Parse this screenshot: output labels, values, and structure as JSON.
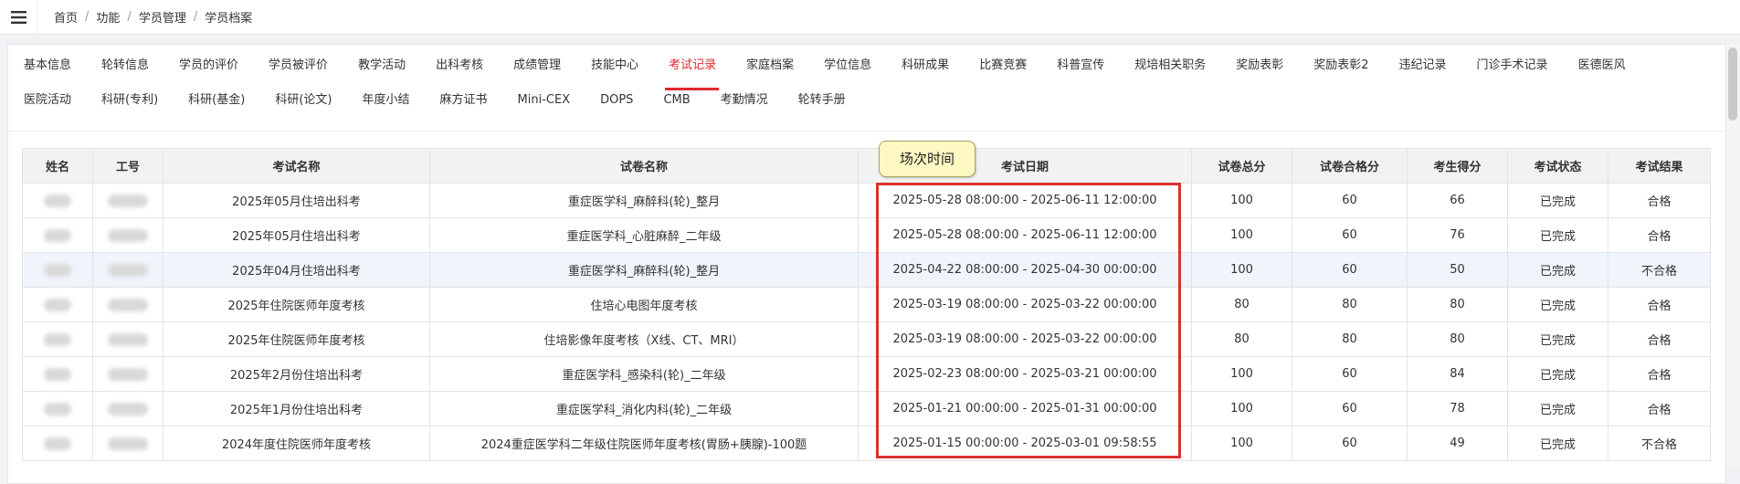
{
  "breadcrumb": [
    "首页",
    "功能",
    "学员管理",
    "学员档案"
  ],
  "breadcrumb_separator": "/",
  "tabs_row1": [
    "基本信息",
    "轮转信息",
    "学员的评价",
    "学员被评价",
    "教学活动",
    "出科考核",
    "成绩管理",
    "技能中心",
    "考试记录",
    "家庭档案",
    "学位信息",
    "科研成果",
    "比赛竞赛",
    "科普宣传",
    "规培相关职务",
    "奖励表彰",
    "奖励表彰2",
    "违纪记录",
    "门诊手术记录",
    "医德医风"
  ],
  "tabs_row2": [
    "医院活动",
    "科研(专利)",
    "科研(基金)",
    "科研(论文)",
    "年度小结",
    "麻方证书",
    "Mini-CEX",
    "DOPS",
    "CMB",
    "考勤情况",
    "轮转手册"
  ],
  "active_tab": "考试记录",
  "table": {
    "headers": [
      "姓名",
      "工号",
      "考试名称",
      "试卷名称",
      "考试日期",
      "试卷总分",
      "试卷合格分",
      "考生得分",
      "考试状态",
      "考试结果"
    ],
    "rows": [
      [
        "2025年05月住培出科考",
        "重症医学科_麻醉科(轮)_整月",
        "2025-05-28 08:00:00 - 2025-06-11 12:00:00",
        "100",
        "60",
        "66",
        "已完成",
        "合格"
      ],
      [
        "2025年05月住培出科考",
        "重症医学科_心脏麻醉_二年级",
        "2025-05-28 08:00:00 - 2025-06-11 12:00:00",
        "100",
        "60",
        "76",
        "已完成",
        "合格"
      ],
      [
        "2025年04月住培出科考",
        "重症医学科_麻醉科(轮)_整月",
        "2025-04-22 08:00:00 - 2025-04-30 00:00:00",
        "100",
        "60",
        "50",
        "已完成",
        "不合格"
      ],
      [
        "2025年住院医师年度考核",
        "住培心电图年度考核",
        "2025-03-19 08:00:00 - 2025-03-22 00:00:00",
        "80",
        "80",
        "80",
        "已完成",
        "合格"
      ],
      [
        "2025年住院医师年度考核",
        "住培影像年度考核（X线、CT、MRI）",
        "2025-03-19 08:00:00 - 2025-03-22 00:00:00",
        "80",
        "80",
        "80",
        "已完成",
        "合格"
      ],
      [
        "2025年2月份住培出科考",
        "重症医学科_感染科(轮)_二年级",
        "2025-02-23 08:00:00 - 2025-03-21 00:00:00",
        "100",
        "60",
        "84",
        "已完成",
        "合格"
      ],
      [
        "2025年1月份住培出科考",
        "重症医学科_消化内科(轮)_二年级",
        "2025-01-21 00:00:00 - 2025-01-31 00:00:00",
        "100",
        "60",
        "78",
        "已完成",
        "合格"
      ],
      [
        "2024年度住院医师年度考核",
        "2024重症医学科二年级住院医师年度考核(胃肠+胰腺)-100题",
        "2025-01-15 00:00:00 - 2025-03-01 09:58:55",
        "100",
        "60",
        "49",
        "已完成",
        "不合格"
      ]
    ],
    "highlighted_row": 2
  },
  "tooltip": "场次时间",
  "colors": {
    "accent": "#e0292f",
    "highlight_box": "#d9302f",
    "tooltip_bg": "#fef9c3"
  },
  "icons": {
    "menu": "hamburger-menu-icon"
  }
}
